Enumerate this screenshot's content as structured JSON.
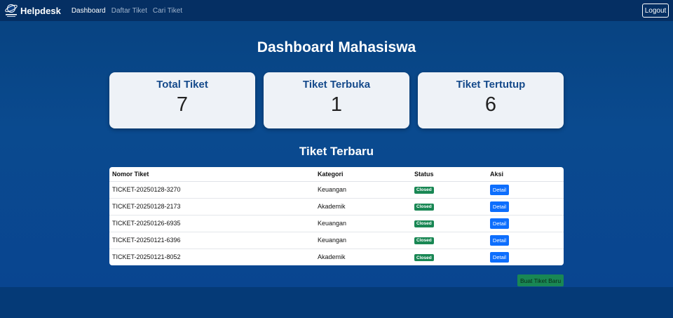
{
  "navbar": {
    "brand": "Helpdesk",
    "logo_icon": "globe-orbit-logo",
    "links": [
      {
        "label": "Dashboard",
        "active": true
      },
      {
        "label": "Daftar Tiket",
        "active": false
      },
      {
        "label": "Cari Tiket",
        "active": false
      }
    ],
    "logout_label": "Logout"
  },
  "page_title": "Dashboard Mahasiswa",
  "stats": [
    {
      "title": "Total Tiket",
      "value": "7"
    },
    {
      "title": "Tiket Terbuka",
      "value": "1"
    },
    {
      "title": "Tiket Tertutup",
      "value": "6"
    }
  ],
  "recent": {
    "title": "Tiket Terbaru",
    "columns": [
      "Nomor Tiket",
      "Kategori",
      "Status",
      "Aksi"
    ],
    "rows": [
      {
        "ticket": "TICKET-20250128-3270",
        "category": "Keuangan",
        "status": "Closed",
        "action": "Detail"
      },
      {
        "ticket": "TICKET-20250128-2173",
        "category": "Akademik",
        "status": "Closed",
        "action": "Detail"
      },
      {
        "ticket": "TICKET-20250126-6935",
        "category": "Keuangan",
        "status": "Closed",
        "action": "Detail"
      },
      {
        "ticket": "TICKET-20250121-6396",
        "category": "Keuangan",
        "status": "Closed",
        "action": "Detail"
      },
      {
        "ticket": "TICKET-20250121-8052",
        "category": "Akademik",
        "status": "Closed",
        "action": "Detail"
      }
    ]
  },
  "new_ticket_label": "Buat Tiket Baru",
  "colors": {
    "navbar": "#052f63",
    "background": "#0a4a8f",
    "card_title": "#154a8b",
    "badge_closed": "#198754",
    "detail_button": "#0d6efd",
    "new_ticket_button": "#198754"
  }
}
